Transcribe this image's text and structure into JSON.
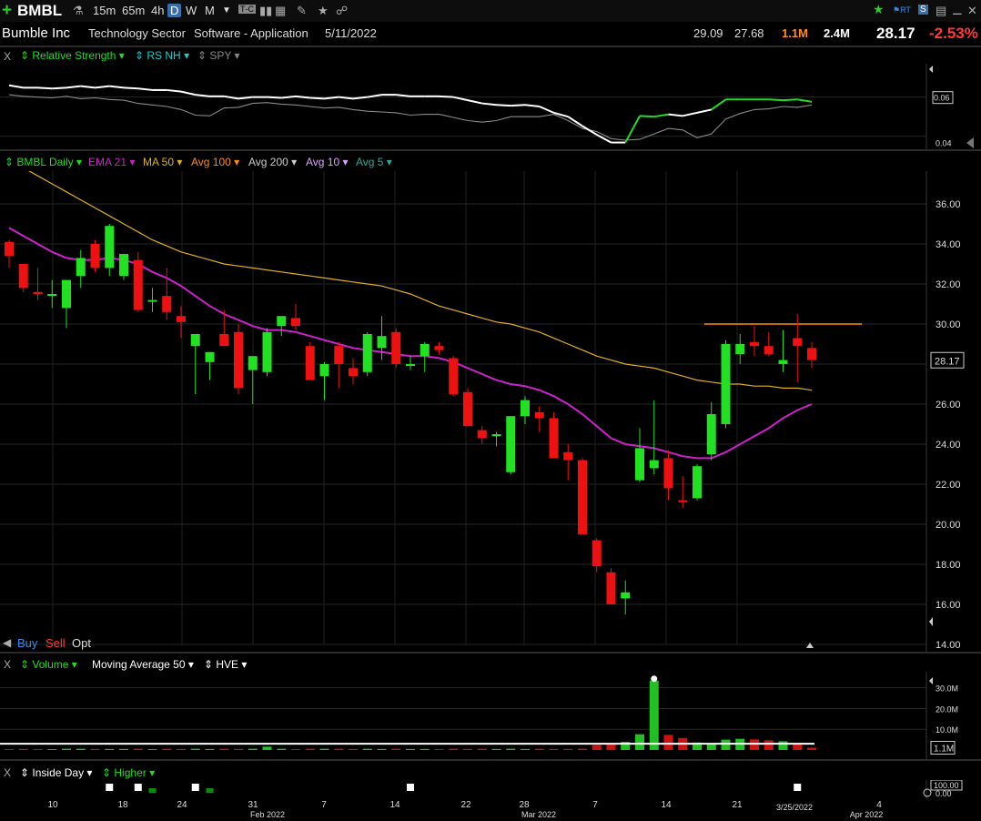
{
  "toolbar": {
    "add_icon": "plus-icon",
    "symbol": "BMBL",
    "timeframes": [
      "15m",
      "65m",
      "4h",
      "D",
      "W",
      "M"
    ],
    "active_timeframe": "D"
  },
  "info": {
    "company": "Bumble Inc",
    "sector": "Technology Sector",
    "industry": "Software - Application",
    "date": "5/11/2022",
    "v1": "29.09",
    "v2": "27.68",
    "vol1": "1.1M",
    "vol2": "2.4M",
    "price": "28.17",
    "change": "-2.53%",
    "change_color": "#ff3b3b"
  },
  "rs_panel": {
    "close": "X",
    "items": [
      "Relative Strength",
      "RS NH",
      "SPY"
    ],
    "ticks": [
      "0.06",
      "0.04"
    ]
  },
  "price_panel": {
    "items": [
      "BMBL Daily",
      "EMA 21",
      "MA 50",
      "Avg 100",
      "Avg 200",
      "Avg 10",
      "Avg 5"
    ],
    "item_colors": [
      "#22dd22",
      "#cc22cc",
      "#e0b020",
      "#ff8c1a",
      "#cccccc",
      "#e0a0ff",
      "#2fa89a"
    ],
    "ticks": [
      "36.00",
      "34.00",
      "32.00",
      "30.00",
      "28.00",
      "26.00",
      "24.00",
      "22.00",
      "20.00",
      "18.00",
      "16.00",
      "14.00"
    ],
    "last_price": "28.17",
    "buy": "Buy",
    "sell": "Sell",
    "opt": "Opt"
  },
  "volume_panel": {
    "close": "X",
    "items": [
      "Volume",
      "Moving Average 50",
      "HVE"
    ],
    "ticks": [
      "30.0M",
      "20.0M",
      "10.0M"
    ],
    "last": "1.1M"
  },
  "inside_panel": {
    "close": "X",
    "items": [
      "Inside Day",
      "Higher"
    ],
    "ticks": [
      "100.00",
      "0.00"
    ]
  },
  "date_axis": {
    "labels": [
      "10",
      "18",
      "24",
      "31",
      "Feb 2022",
      "7",
      "14",
      "22",
      "28",
      "Mar 2022",
      "7",
      "14",
      "21",
      "3/25/2022",
      "4",
      "Apr 2022"
    ]
  },
  "chart_data": {
    "type": "candlestick",
    "candles": [
      {
        "o": 34.1,
        "h": 34.2,
        "l": 32.8,
        "c": 33.4
      },
      {
        "o": 33.0,
        "h": 33.0,
        "l": 31.6,
        "c": 31.8
      },
      {
        "o": 31.6,
        "h": 32.8,
        "l": 31.2,
        "c": 31.5
      },
      {
        "o": 31.5,
        "h": 32.2,
        "l": 30.8,
        "c": 31.5
      },
      {
        "o": 30.8,
        "h": 32.0,
        "l": 29.8,
        "c": 32.2
      },
      {
        "o": 32.4,
        "h": 33.7,
        "l": 31.8,
        "c": 33.3
      },
      {
        "o": 34.0,
        "h": 34.2,
        "l": 32.6,
        "c": 32.8
      },
      {
        "o": 32.8,
        "h": 35.0,
        "l": 32.4,
        "c": 34.9
      },
      {
        "o": 32.4,
        "h": 33.5,
        "l": 32.2,
        "c": 33.5
      },
      {
        "o": 33.2,
        "h": 33.6,
        "l": 30.6,
        "c": 30.7
      },
      {
        "o": 31.2,
        "h": 31.8,
        "l": 30.6,
        "c": 31.2
      },
      {
        "o": 31.4,
        "h": 32.8,
        "l": 30.2,
        "c": 30.6
      },
      {
        "o": 30.4,
        "h": 30.9,
        "l": 29.3,
        "c": 30.1
      },
      {
        "o": 28.9,
        "h": 29.5,
        "l": 26.5,
        "c": 29.5
      },
      {
        "o": 28.1,
        "h": 28.6,
        "l": 27.2,
        "c": 28.6
      },
      {
        "o": 29.5,
        "h": 30.7,
        "l": 28.9,
        "c": 28.9
      },
      {
        "o": 29.6,
        "h": 30.0,
        "l": 26.5,
        "c": 26.8
      },
      {
        "o": 27.7,
        "h": 28.4,
        "l": 26.0,
        "c": 28.4
      },
      {
        "o": 27.6,
        "h": 29.8,
        "l": 27.4,
        "c": 29.6
      },
      {
        "o": 29.9,
        "h": 30.1,
        "l": 29.4,
        "c": 30.4
      },
      {
        "o": 30.3,
        "h": 31.0,
        "l": 29.7,
        "c": 29.9
      },
      {
        "o": 28.9,
        "h": 29.1,
        "l": 27.2,
        "c": 27.2
      },
      {
        "o": 27.4,
        "h": 28.1,
        "l": 26.2,
        "c": 28.0
      },
      {
        "o": 28.9,
        "h": 29.1,
        "l": 26.8,
        "c": 28.0
      },
      {
        "o": 27.8,
        "h": 28.3,
        "l": 27.0,
        "c": 27.4
      },
      {
        "o": 27.6,
        "h": 29.6,
        "l": 27.4,
        "c": 29.5
      },
      {
        "o": 28.8,
        "h": 30.4,
        "l": 28.2,
        "c": 29.4
      },
      {
        "o": 29.6,
        "h": 29.8,
        "l": 27.8,
        "c": 28.0
      },
      {
        "o": 28.0,
        "h": 28.4,
        "l": 27.7,
        "c": 28.0
      },
      {
        "o": 28.4,
        "h": 29.1,
        "l": 27.6,
        "c": 29.0
      },
      {
        "o": 28.9,
        "h": 29.1,
        "l": 28.5,
        "c": 28.7
      },
      {
        "o": 28.3,
        "h": 28.4,
        "l": 26.4,
        "c": 26.5
      },
      {
        "o": 26.6,
        "h": 26.8,
        "l": 24.9,
        "c": 24.9
      },
      {
        "o": 24.7,
        "h": 24.9,
        "l": 24.0,
        "c": 24.3
      },
      {
        "o": 24.4,
        "h": 24.6,
        "l": 23.9,
        "c": 24.5
      },
      {
        "o": 22.6,
        "h": 25.4,
        "l": 22.5,
        "c": 25.4
      },
      {
        "o": 25.4,
        "h": 26.4,
        "l": 25.0,
        "c": 26.2
      },
      {
        "o": 25.6,
        "h": 25.9,
        "l": 24.6,
        "c": 25.3
      },
      {
        "o": 25.3,
        "h": 25.6,
        "l": 23.3,
        "c": 23.3
      },
      {
        "o": 23.6,
        "h": 24.0,
        "l": 22.2,
        "c": 23.2
      },
      {
        "o": 23.2,
        "h": 23.3,
        "l": 19.5,
        "c": 19.5
      },
      {
        "o": 19.2,
        "h": 19.3,
        "l": 17.6,
        "c": 17.9
      },
      {
        "o": 17.6,
        "h": 17.8,
        "l": 16.0,
        "c": 16.0
      },
      {
        "o": 16.3,
        "h": 17.2,
        "l": 15.5,
        "c": 16.6
      },
      {
        "o": 22.2,
        "h": 24.8,
        "l": 22.1,
        "c": 23.8
      },
      {
        "o": 22.8,
        "h": 26.2,
        "l": 22.5,
        "c": 23.2
      },
      {
        "o": 23.3,
        "h": 23.7,
        "l": 21.2,
        "c": 21.8
      },
      {
        "o": 21.2,
        "h": 22.4,
        "l": 20.8,
        "c": 21.1
      },
      {
        "o": 21.3,
        "h": 23.0,
        "l": 21.2,
        "c": 22.9
      },
      {
        "o": 23.5,
        "h": 26.1,
        "l": 23.2,
        "c": 25.5
      },
      {
        "o": 25.0,
        "h": 29.2,
        "l": 24.8,
        "c": 29.0
      },
      {
        "o": 28.5,
        "h": 29.5,
        "l": 28.0,
        "c": 29.0
      },
      {
        "o": 29.1,
        "h": 29.9,
        "l": 28.4,
        "c": 28.9
      },
      {
        "o": 28.9,
        "h": 29.6,
        "l": 28.4,
        "c": 28.5
      },
      {
        "o": 28.0,
        "h": 29.7,
        "l": 27.6,
        "c": 28.2
      },
      {
        "o": 29.3,
        "h": 30.5,
        "l": 27.1,
        "c": 28.9
      },
      {
        "o": 28.8,
        "h": 29.1,
        "l": 27.8,
        "c": 28.2
      }
    ],
    "ema21": [
      34.8,
      34.4,
      34.0,
      33.6,
      33.3,
      33.2,
      33.2,
      33.3,
      33.2,
      33.0,
      32.6,
      32.3,
      31.9,
      31.4,
      30.9,
      30.5,
      30.2,
      29.9,
      29.7,
      29.7,
      29.6,
      29.4,
      29.2,
      29.0,
      28.8,
      28.7,
      28.6,
      28.5,
      28.4,
      28.4,
      28.3,
      28.1,
      27.8,
      27.5,
      27.2,
      27.0,
      26.9,
      26.7,
      26.4,
      26.0,
      25.5,
      24.9,
      24.3,
      24.0,
      23.9,
      23.8,
      23.6,
      23.4,
      23.3,
      23.3,
      23.6,
      24.0,
      24.4,
      24.8,
      25.3,
      25.7,
      26.0
    ],
    "ma50": [
      38.2,
      37.8,
      37.4,
      37.0,
      36.6,
      36.2,
      35.8,
      35.4,
      35.0,
      34.6,
      34.2,
      33.9,
      33.6,
      33.4,
      33.2,
      33.0,
      32.9,
      32.8,
      32.7,
      32.6,
      32.5,
      32.4,
      32.3,
      32.2,
      32.1,
      32.0,
      31.9,
      31.7,
      31.5,
      31.2,
      30.9,
      30.7,
      30.5,
      30.3,
      30.1,
      30.0,
      29.8,
      29.6,
      29.3,
      29.0,
      28.7,
      28.4,
      28.2,
      28.0,
      27.9,
      27.8,
      27.6,
      27.4,
      27.2,
      27.1,
      27.0,
      27.0,
      26.9,
      26.9,
      26.8,
      26.8,
      26.7
    ],
    "resistance": 30.0,
    "ylim": [
      14.0,
      37.0
    ],
    "rs_line": [
      0.0615,
      0.0612,
      0.0612,
      0.0611,
      0.0612,
      0.0614,
      0.0612,
      0.0614,
      0.0612,
      0.0611,
      0.0609,
      0.0609,
      0.0607,
      0.0603,
      0.0601,
      0.0601,
      0.0598,
      0.06,
      0.06,
      0.0599,
      0.0601,
      0.0599,
      0.0598,
      0.06,
      0.0598,
      0.06,
      0.0603,
      0.0603,
      0.0601,
      0.0601,
      0.0601,
      0.06,
      0.0596,
      0.0592,
      0.059,
      0.0589,
      0.059,
      0.0588,
      0.058,
      0.0575,
      0.0563,
      0.0552,
      0.0542,
      0.0542,
      0.0576,
      0.0575,
      0.0578,
      0.0576,
      0.058,
      0.0584,
      0.0597,
      0.0597,
      0.0597,
      0.0597,
      0.0596,
      0.0597,
      0.0594
    ],
    "spy_line": [
      0.0603,
      0.0601,
      0.06,
      0.0599,
      0.0601,
      0.0598,
      0.0599,
      0.0597,
      0.0596,
      0.0592,
      0.059,
      0.0588,
      0.0584,
      0.0577,
      0.0576,
      0.0586,
      0.0587,
      0.0592,
      0.0593,
      0.0591,
      0.059,
      0.0588,
      0.0586,
      0.0587,
      0.0584,
      0.0582,
      0.0581,
      0.058,
      0.0577,
      0.0578,
      0.0578,
      0.0574,
      0.057,
      0.0568,
      0.057,
      0.0575,
      0.0575,
      0.0575,
      0.0578,
      0.057,
      0.056,
      0.0556,
      0.0547,
      0.0545,
      0.0546,
      0.0553,
      0.056,
      0.0558,
      0.0548,
      0.0553,
      0.0572,
      0.0579,
      0.0584,
      0.0585,
      0.0588,
      0.0587,
      0.059
    ],
    "rs_ylim": [
      0.0538,
      0.0638
    ],
    "volume": [
      0.4,
      0.5,
      0.4,
      0.4,
      0.6,
      0.6,
      0.5,
      0.5,
      0.5,
      0.6,
      0.4,
      0.6,
      0.5,
      0.6,
      0.5,
      0.6,
      0.5,
      0.6,
      1.6,
      0.6,
      0.4,
      0.6,
      0.6,
      0.6,
      0.5,
      0.6,
      0.5,
      0.6,
      0.5,
      0.5,
      0.4,
      0.6,
      0.5,
      0.6,
      0.5,
      0.6,
      0.5,
      0.6,
      0.5,
      0.5,
      0.6,
      2.4,
      2.9,
      3.9,
      7.6,
      33.5,
      7.3,
      5.8,
      3.6,
      3.3,
      5.0,
      5.4,
      5.1,
      4.7,
      4.2,
      2.7,
      1.1
    ],
    "vol_ylim": [
      0,
      36
    ],
    "vol_ma": 3.0
  }
}
